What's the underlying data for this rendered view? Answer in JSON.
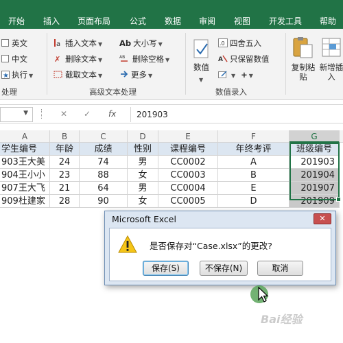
{
  "menu": [
    "开始",
    "插入",
    "页面布局",
    "公式",
    "数据",
    "审阅",
    "视图",
    "开发工具",
    "帮助"
  ],
  "ribbon": {
    "left_group": {
      "items": [
        "英文",
        "中文",
        "执行"
      ],
      "group_label": "处理"
    },
    "advanced_text": {
      "items": [
        "插入文本",
        "删除文本",
        "截取文本",
        "大小写",
        "删除空格",
        "更多"
      ],
      "group_label": "高级文本处理",
      "ab_prefix": "Ab"
    },
    "numeric_entry": {
      "items": [
        "数值",
        "四舍五入",
        "只保留数值"
      ],
      "group_label": "数值录入",
      "plus": "+"
    },
    "right_group": {
      "copy_paste": "复制粘贴",
      "new_insert": "新增插入"
    }
  },
  "formula_bar": {
    "cancel": "✕",
    "confirm": "✓",
    "fx": "fx",
    "value": "201903"
  },
  "columns": [
    "A",
    "B",
    "C",
    "D",
    "E",
    "F",
    "G"
  ],
  "header_row": [
    "学生编号",
    "年龄",
    "成绩",
    "性别",
    "课程编号",
    "年终考评",
    "班级编号"
  ],
  "rows": [
    [
      "903王大美",
      "24",
      "74",
      "男",
      "CC0002",
      "A",
      "201903"
    ],
    [
      "904王小小",
      "23",
      "88",
      "女",
      "CC0003",
      "B",
      "201904"
    ],
    [
      "907王大飞",
      "21",
      "64",
      "男",
      "CC0004",
      "E",
      "201907"
    ],
    [
      "909杜建家",
      "28",
      "90",
      "女",
      "CC0005",
      "D",
      "201909"
    ]
  ],
  "dialog": {
    "title": "Microsoft Excel",
    "message": "是否保存对“Case.xlsx”的更改?",
    "buttons": [
      "保存(S)",
      "不保存(N)",
      "取消"
    ],
    "close": "✕"
  },
  "watermark": "Bai经验",
  "colors": {
    "accent": "#217346",
    "header_fill": "#dce6f1",
    "selection_fill": "#c9c9c9"
  }
}
